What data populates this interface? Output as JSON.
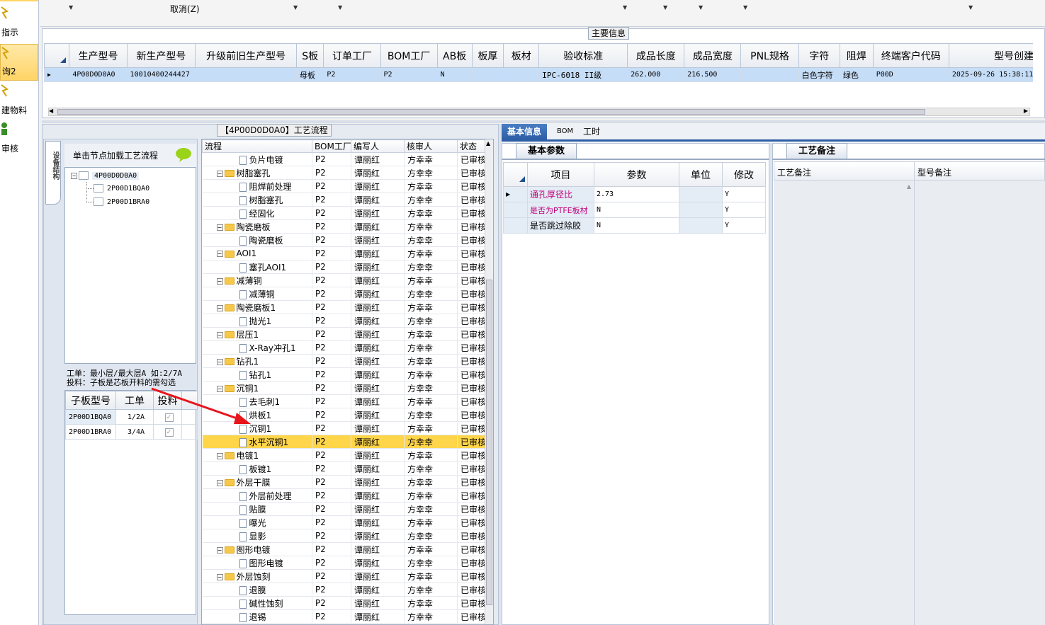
{
  "left_nav": {
    "items": [
      {
        "label": "指示",
        "icon": "wand-icon"
      },
      {
        "label": "询2",
        "icon": "wand-icon"
      },
      {
        "label": "建物料",
        "icon": "wand-icon"
      },
      {
        "label": "审核",
        "icon": "person-icon"
      }
    ]
  },
  "toolbar": {
    "cancel_label": "取消(Z)"
  },
  "main_info": {
    "title": "主要信息",
    "columns": [
      "生产型号",
      "新生产型号",
      "升级前旧生产型号",
      "S板",
      "订单工厂",
      "BOM工厂",
      "AB板",
      "板厚",
      "板材",
      "验收标准",
      "成品长度",
      "成品宽度",
      "PNL规格",
      "字符",
      "阻焊",
      "终端客户代码",
      "型号创建时间"
    ],
    "row": [
      "4P00D0D0A0",
      "10010400244427",
      "",
      "母板",
      "P2",
      "P2",
      "N",
      "",
      "",
      "IPC-6018 II级",
      "262.000",
      "216.500",
      "",
      "白色字符",
      "绿色",
      "P00D",
      "2025-09-26 15:38:11"
    ]
  },
  "flow_panel_title": "【4P00D0D0A0】工艺流程",
  "struct_panel": {
    "side_tab": "设备结构",
    "tree_header": "单击节点加载工艺流程",
    "tree": {
      "root": "4P00D0D0A0",
      "children": [
        "2P00D1BQA0",
        "2P00D1BRA0"
      ]
    },
    "note_line1": "工单：最小层/最大层A 如:2/7A",
    "note_line2": "投料：子板是芯板开料的需勾选",
    "sub_columns": [
      "子板型号",
      "工单",
      "投料"
    ],
    "sub_rows": [
      {
        "model": "2P00D1BQA0",
        "order": "1/2A"
      },
      {
        "model": "2P00D1BRA0",
        "order": "3/4A"
      }
    ]
  },
  "flow_table": {
    "columns": [
      "流程",
      "BOM工厂",
      "编写人",
      "核审人",
      "状态"
    ],
    "rows": [
      {
        "name": "负片电镀",
        "type": "doc",
        "factory": "P2",
        "writer": "谭丽红",
        "reviewer": "方幸幸",
        "status": "已审核"
      },
      {
        "name": "树脂塞孔",
        "type": "folder",
        "factory": "P2",
        "writer": "谭丽红",
        "reviewer": "方幸幸",
        "status": "已审核"
      },
      {
        "name": "阻焊前处理",
        "type": "doc",
        "factory": "P2",
        "writer": "谭丽红",
        "reviewer": "方幸幸",
        "status": "已审核"
      },
      {
        "name": "树脂塞孔",
        "type": "doc",
        "factory": "P2",
        "writer": "谭丽红",
        "reviewer": "方幸幸",
        "status": "已审核"
      },
      {
        "name": "经固化",
        "type": "doc",
        "factory": "P2",
        "writer": "谭丽红",
        "reviewer": "方幸幸",
        "status": "已审核"
      },
      {
        "name": "陶瓷磨板",
        "type": "folder",
        "factory": "P2",
        "writer": "谭丽红",
        "reviewer": "方幸幸",
        "status": "已审核"
      },
      {
        "name": "陶瓷磨板",
        "type": "doc",
        "factory": "P2",
        "writer": "谭丽红",
        "reviewer": "方幸幸",
        "status": "已审核"
      },
      {
        "name": "AOI1",
        "type": "folder",
        "factory": "P2",
        "writer": "谭丽红",
        "reviewer": "方幸幸",
        "status": "已审核"
      },
      {
        "name": "塞孔AOI1",
        "type": "doc",
        "factory": "P2",
        "writer": "谭丽红",
        "reviewer": "方幸幸",
        "status": "已审核"
      },
      {
        "name": "减薄铜",
        "type": "folder",
        "factory": "P2",
        "writer": "谭丽红",
        "reviewer": "方幸幸",
        "status": "已审核"
      },
      {
        "name": "减薄铜",
        "type": "doc",
        "factory": "P2",
        "writer": "谭丽红",
        "reviewer": "方幸幸",
        "status": "已审核"
      },
      {
        "name": "陶瓷磨板1",
        "type": "folder",
        "factory": "P2",
        "writer": "谭丽红",
        "reviewer": "方幸幸",
        "status": "已审核"
      },
      {
        "name": "抛光1",
        "type": "doc",
        "factory": "P2",
        "writer": "谭丽红",
        "reviewer": "方幸幸",
        "status": "已审核"
      },
      {
        "name": "层压1",
        "type": "folder",
        "factory": "P2",
        "writer": "谭丽红",
        "reviewer": "方幸幸",
        "status": "已审核"
      },
      {
        "name": "X-Ray冲孔1",
        "type": "doc",
        "factory": "P2",
        "writer": "谭丽红",
        "reviewer": "方幸幸",
        "status": "已审核"
      },
      {
        "name": "钻孔1",
        "type": "folder",
        "factory": "P2",
        "writer": "谭丽红",
        "reviewer": "方幸幸",
        "status": "已审核"
      },
      {
        "name": "钻孔1",
        "type": "doc",
        "factory": "P2",
        "writer": "谭丽红",
        "reviewer": "方幸幸",
        "status": "已审核"
      },
      {
        "name": "沉铜1",
        "type": "folder",
        "factory": "P2",
        "writer": "谭丽红",
        "reviewer": "方幸幸",
        "status": "已审核"
      },
      {
        "name": "去毛刺1",
        "type": "doc",
        "factory": "P2",
        "writer": "谭丽红",
        "reviewer": "方幸幸",
        "status": "已审核"
      },
      {
        "name": "烘板1",
        "type": "doc",
        "factory": "P2",
        "writer": "谭丽红",
        "reviewer": "方幸幸",
        "status": "已审核"
      },
      {
        "name": "沉铜1",
        "type": "doc",
        "factory": "P2",
        "writer": "谭丽红",
        "reviewer": "方幸幸",
        "status": "已审核"
      },
      {
        "name": "水平沉铜1",
        "type": "doc",
        "factory": "P2",
        "writer": "谭丽红",
        "reviewer": "方幸幸",
        "status": "已审核",
        "selected": true
      },
      {
        "name": "电镀1",
        "type": "folder",
        "factory": "P2",
        "writer": "谭丽红",
        "reviewer": "方幸幸",
        "status": "已审核"
      },
      {
        "name": "板镀1",
        "type": "doc",
        "factory": "P2",
        "writer": "谭丽红",
        "reviewer": "方幸幸",
        "status": "已审核"
      },
      {
        "name": "外层干膜",
        "type": "folder",
        "factory": "P2",
        "writer": "谭丽红",
        "reviewer": "方幸幸",
        "status": "已审核"
      },
      {
        "name": "外层前处理",
        "type": "doc",
        "factory": "P2",
        "writer": "谭丽红",
        "reviewer": "方幸幸",
        "status": "已审核"
      },
      {
        "name": "贴膜",
        "type": "doc",
        "factory": "P2",
        "writer": "谭丽红",
        "reviewer": "方幸幸",
        "status": "已审核"
      },
      {
        "name": "曝光",
        "type": "doc",
        "factory": "P2",
        "writer": "谭丽红",
        "reviewer": "方幸幸",
        "status": "已审核"
      },
      {
        "name": "显影",
        "type": "doc",
        "factory": "P2",
        "writer": "谭丽红",
        "reviewer": "方幸幸",
        "status": "已审核"
      },
      {
        "name": "图形电镀",
        "type": "folder",
        "factory": "P2",
        "writer": "谭丽红",
        "reviewer": "方幸幸",
        "status": "已审核"
      },
      {
        "name": "图形电镀",
        "type": "doc",
        "factory": "P2",
        "writer": "谭丽红",
        "reviewer": "方幸幸",
        "status": "已审核"
      },
      {
        "name": "外层蚀刻",
        "type": "folder",
        "factory": "P2",
        "writer": "谭丽红",
        "reviewer": "方幸幸",
        "status": "已审核"
      },
      {
        "name": "退膜",
        "type": "doc",
        "factory": "P2",
        "writer": "谭丽红",
        "reviewer": "方幸幸",
        "status": "已审核"
      },
      {
        "name": "碱性蚀刻",
        "type": "doc",
        "factory": "P2",
        "writer": "谭丽红",
        "reviewer": "方幸幸",
        "status": "已审核"
      },
      {
        "name": "退锡",
        "type": "doc",
        "factory": "P2",
        "writer": "谭丽红",
        "reviewer": "方幸幸",
        "status": "已审核"
      }
    ]
  },
  "right_tabs": [
    "基本信息",
    "BOM",
    "工时"
  ],
  "basic_params": {
    "tab_label": "基本参数",
    "columns": [
      "项目",
      "参数",
      "单位",
      "修改"
    ],
    "rows": [
      {
        "item": "通孔厚径比",
        "value": "2.73",
        "unit": "",
        "modify": "Y",
        "highlight": true
      },
      {
        "item": "是否为PTFE板材",
        "value": "N",
        "unit": "",
        "modify": "Y",
        "highlight": true
      },
      {
        "item": "是否跳过除胶",
        "value": "N",
        "unit": "",
        "modify": "Y",
        "highlight": false
      }
    ]
  },
  "remarks": {
    "tab_label": "工艺备注",
    "columns": [
      "工艺备注",
      "型号备注"
    ]
  },
  "colors": {
    "accent": "#2d5ea6",
    "selected_row": "#ffd54a",
    "grid_selected": "#c6ddf7",
    "highlight_text": "#c0007a",
    "arrow": "#e8141c"
  }
}
